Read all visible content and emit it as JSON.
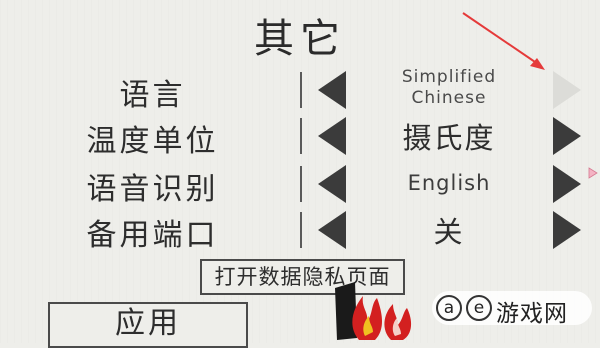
{
  "title": "其它",
  "settings": [
    {
      "label": "语言",
      "value_lines": [
        "Simplified",
        "Chinese"
      ],
      "right_disabled": true
    },
    {
      "label": "温度单位",
      "value": "摄氏度"
    },
    {
      "label": "语音识别",
      "value": "English"
    },
    {
      "label": "备用端口",
      "value": "关"
    }
  ],
  "privacy_button": "打开数据隐私页面",
  "apply_button": "应用",
  "watermark": {
    "at1": "a",
    "at2": "e",
    "text": "游戏网"
  },
  "colors": {
    "background": "#eeeeea",
    "arrow": "#3b3b3b",
    "annotation": "#e53a3a"
  }
}
